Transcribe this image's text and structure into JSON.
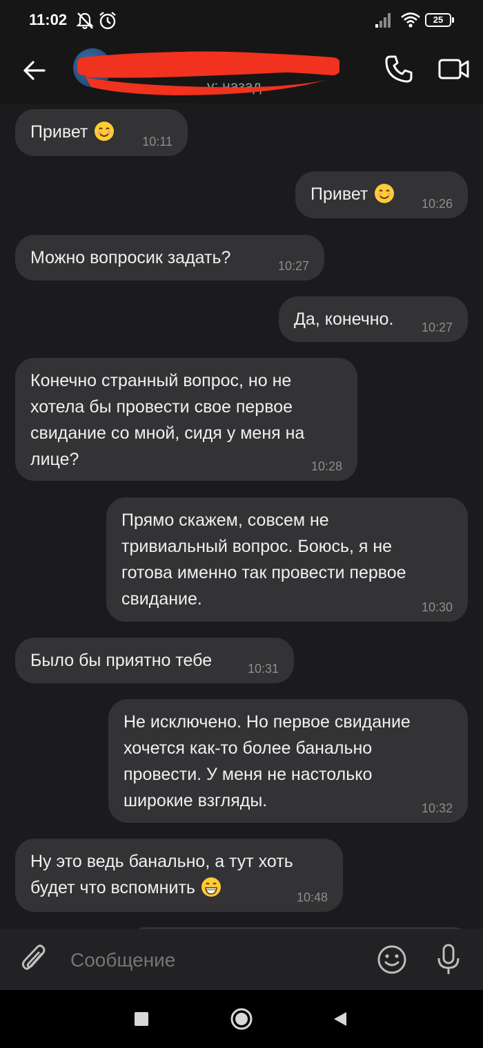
{
  "status_bar": {
    "time": "11:02",
    "battery": "25",
    "icons": [
      "mute-notifications-icon",
      "alarm-icon",
      "signal-icon",
      "wifi-icon",
      "battery-icon"
    ]
  },
  "header": {
    "last_seen_partial": "у: назад",
    "icons": [
      "back-arrow-icon",
      "phone-call-icon",
      "video-call-icon"
    ]
  },
  "messages": [
    {
      "side": "in",
      "text": "Привет",
      "emoji": "smiling-face",
      "time": "10:11"
    },
    {
      "side": "out",
      "text": "Привет",
      "emoji": "smiling-face",
      "time": "10:26"
    },
    {
      "side": "in",
      "text": "Можно вопросик задать?",
      "time": "10:27"
    },
    {
      "side": "out",
      "text": "Да, конечно.",
      "time": "10:27"
    },
    {
      "side": "in",
      "text": "Конечно странный вопрос, но не\nхотела бы провести свое первое\nсвидание со мной, сидя у меня на\nлице?",
      "time": "10:28"
    },
    {
      "side": "out",
      "text": "Прямо скажем, совсем не\nтривиальный вопрос. Боюсь, я не\nготова именно так провести первое\nсвидание.",
      "time": "10:30"
    },
    {
      "side": "in",
      "text": "Было бы приятно тебе",
      "time": "10:31"
    },
    {
      "side": "out",
      "text": "Не исключено. Но первое свидание\nхочется как-то более банально\nпровести. У меня не настолько\nширокие взгляды.",
      "time": "10:32"
    },
    {
      "side": "in",
      "text": "Ну это ведь банально, а тут хоть\nбудет что вспомнить",
      "emoji": "grinning-face",
      "time": "10:48"
    }
  ],
  "composer": {
    "placeholder": "Сообщение"
  },
  "colors": {
    "background": "#1b1b1d",
    "bubble": "#333335",
    "redaction": "#f0321e"
  }
}
